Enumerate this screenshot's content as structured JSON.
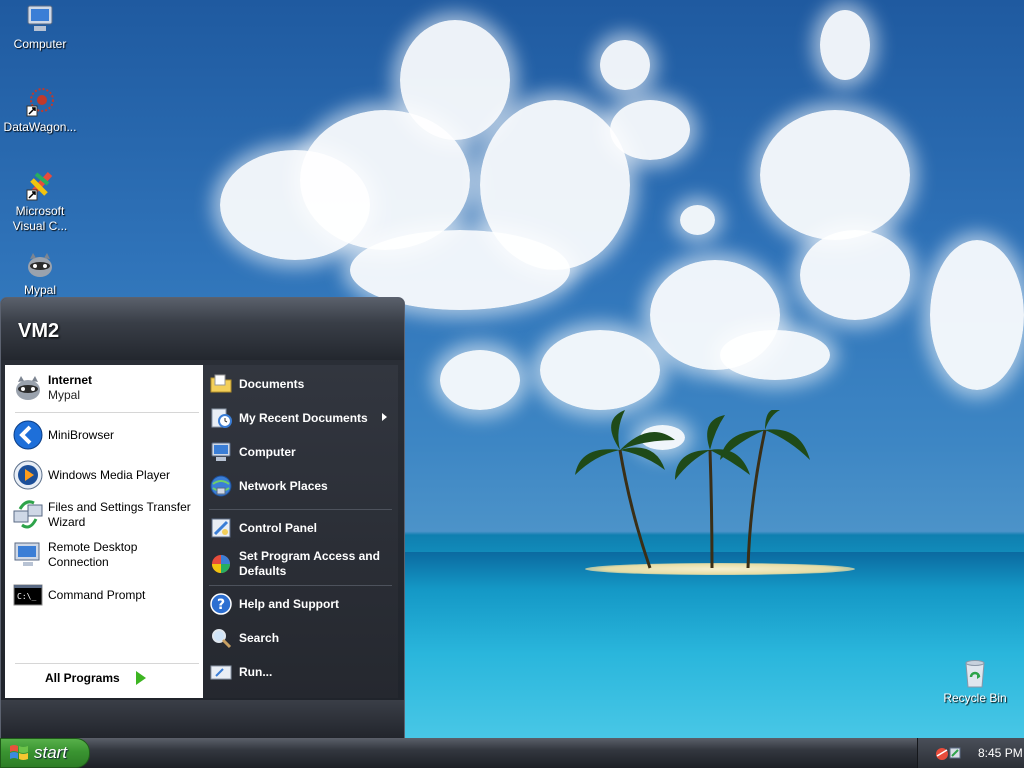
{
  "desktop": {
    "icons": [
      {
        "label": "Computer",
        "icon": "computer-icon"
      },
      {
        "label": "DataWagon...",
        "icon": "datawagon-icon"
      },
      {
        "label": "Microsoft Visual C...",
        "icon": "visual-c-icon"
      },
      {
        "label": "Mypal",
        "icon": "mypal-icon"
      },
      {
        "label": "Recycle Bin",
        "icon": "recycle-bin-icon"
      }
    ]
  },
  "start_menu": {
    "user_name": "VM2",
    "left_items": [
      {
        "label": "Internet",
        "sublabel": "Mypal",
        "icon": "mypal-icon"
      },
      {
        "label": "MiniBrowser",
        "icon": "minibrowser-icon"
      },
      {
        "label": "Windows Media Player",
        "icon": "media-player-icon"
      },
      {
        "label": "Files and Settings Transfer Wizard",
        "icon": "transfer-wizard-icon"
      },
      {
        "label": "Remote Desktop Connection",
        "icon": "remote-desktop-icon"
      },
      {
        "label": "Command Prompt",
        "icon": "command-prompt-icon"
      }
    ],
    "all_programs": "All Programs",
    "right_items": [
      {
        "label": "Documents",
        "icon": "documents-folder-icon"
      },
      {
        "label": "My Recent Documents",
        "icon": "recent-documents-icon"
      },
      {
        "label": "Computer",
        "icon": "computer-icon"
      },
      {
        "label": "Network Places",
        "icon": "network-places-icon"
      },
      {
        "label": "Control Panel",
        "icon": "control-panel-icon"
      },
      {
        "label": "Set Program Access and Defaults",
        "icon": "program-defaults-icon"
      },
      {
        "label": "Help and Support",
        "icon": "help-icon"
      },
      {
        "label": "Search",
        "icon": "search-icon"
      },
      {
        "label": "Run...",
        "icon": "run-icon"
      }
    ]
  },
  "taskbar": {
    "start_label": "start",
    "clock": "8:45 PM"
  },
  "colors": {
    "start_button": "#3a9431",
    "menu_dark": "#25282f",
    "all_programs_arrow": "#3db522"
  }
}
